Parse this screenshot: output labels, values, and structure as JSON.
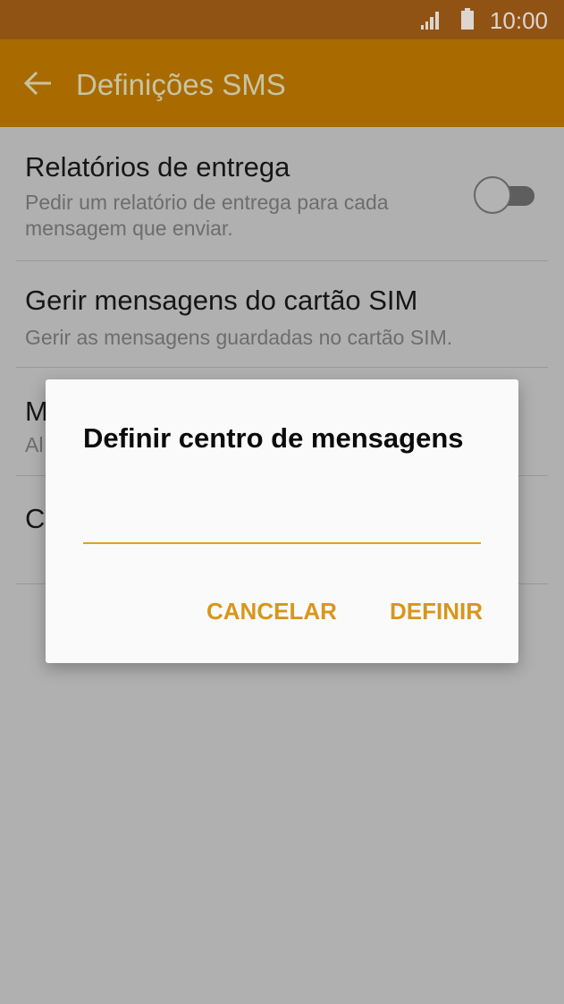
{
  "status_bar": {
    "time": "10:00",
    "signal_icon": "signal-icon",
    "battery_icon": "battery-icon"
  },
  "app_bar": {
    "title": "Definições SMS",
    "back_icon": "arrow-left-icon",
    "color": "#a96b00"
  },
  "settings": [
    {
      "title": "Relatórios de entrega",
      "subtitle": "Pedir um relatório de entrega para cada mensagem que enviar.",
      "subtitle_lines": [
        "Pedir um relatório de entrega para cada",
        "mensagem que enviar."
      ],
      "toggle": "off"
    },
    {
      "title": "Gerir mensagens do cartão SIM",
      "subtitle": "Gerir as mensagens guardadas no cartão SIM."
    },
    {
      "title_visible": "M",
      "subtitle_visible": "Al"
    },
    {
      "title_visible": "C"
    }
  ],
  "dialog": {
    "title": "Definir centro de mensagens",
    "input_value": "",
    "cancel_label": "CANCELAR",
    "confirm_label": "DEFINIR",
    "accent_color": "#e1a11c"
  }
}
